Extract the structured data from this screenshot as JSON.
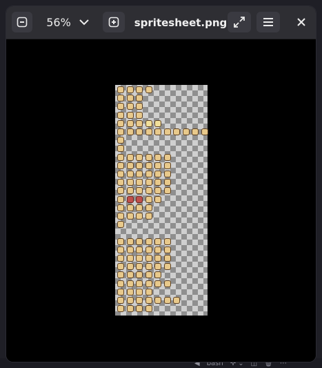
{
  "window": {
    "title": "spritesheet.png",
    "zoom_value": "56%"
  },
  "icons": {
    "zoom_out": "minus-square-icon",
    "zoom_dropdown": "chevron-down-icon",
    "zoom_in": "plus-square-icon",
    "fullscreen": "expand-icon",
    "menu": "hamburger-menu-icon",
    "close": "close-icon"
  },
  "background_terminal": {
    "label": "bash"
  },
  "colors": {
    "header": "#2e2e33",
    "viewer": "#000000",
    "button": "#3a3a41",
    "checker_light": "#cfcfcf",
    "checker_dark": "#8f8f8f",
    "sprite": "#e8c98b",
    "sprite_red": "#c0504b"
  }
}
